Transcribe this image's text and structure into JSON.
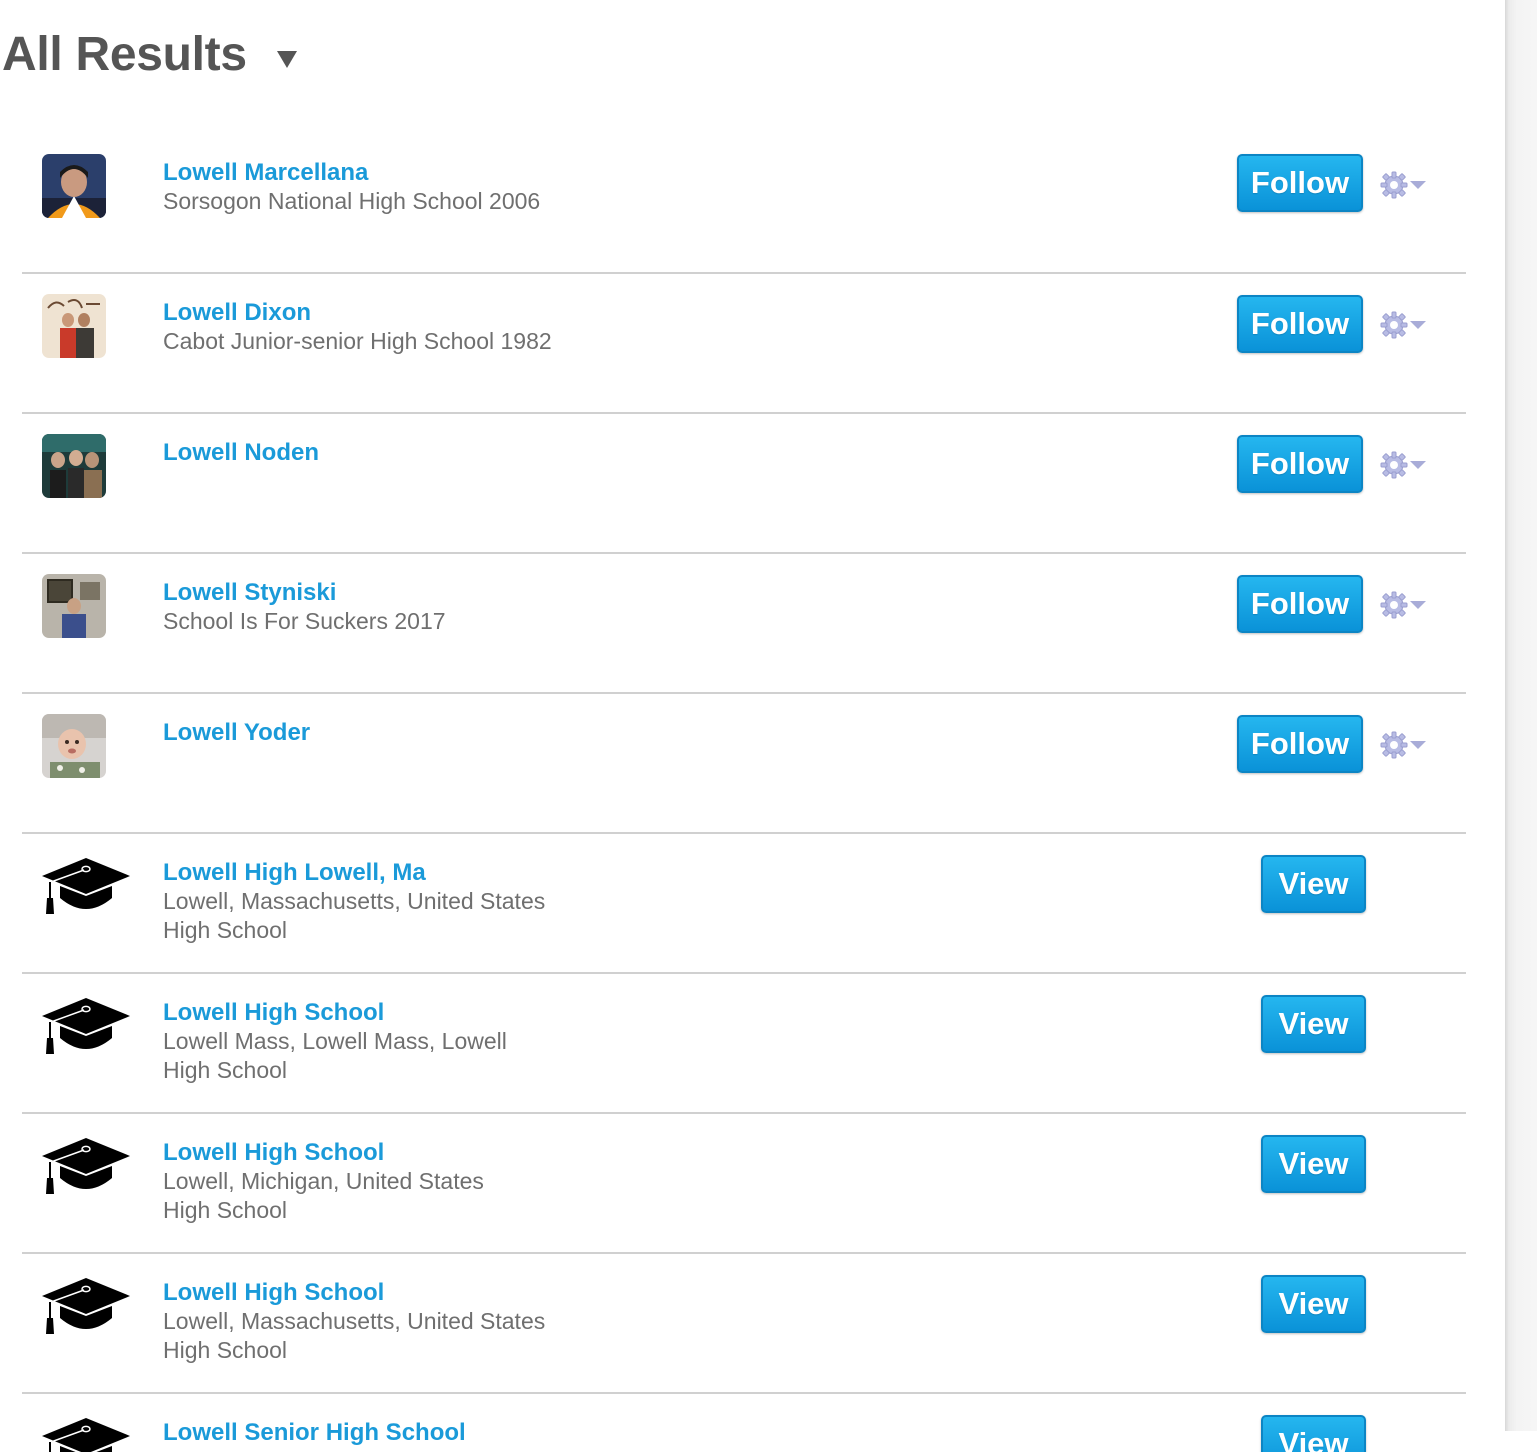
{
  "header": {
    "title": "All Results"
  },
  "buttons": {
    "follow": "Follow",
    "view": "View"
  },
  "people": [
    {
      "name": "Lowell Marcellana",
      "school": "Sorsogon National High School 2006"
    },
    {
      "name": "Lowell Dixon",
      "school": "Cabot Junior-senior High School 1982"
    },
    {
      "name": "Lowell Noden",
      "school": ""
    },
    {
      "name": "Lowell Styniski",
      "school": "School Is For Suckers 2017"
    },
    {
      "name": "Lowell Yoder",
      "school": ""
    }
  ],
  "schools": [
    {
      "name": "Lowell High Lowell, Ma",
      "location": "Lowell, Massachusetts, United States",
      "type": "High School"
    },
    {
      "name": "Lowell High School",
      "location": "Lowell Mass, Lowell Mass, Lowell",
      "type": "High School"
    },
    {
      "name": "Lowell High School",
      "location": "Lowell, Michigan, United States",
      "type": "High School"
    },
    {
      "name": "Lowell High School",
      "location": "Lowell, Massachusetts, United States",
      "type": "High School"
    },
    {
      "name": "Lowell Senior High School",
      "location": "",
      "type": ""
    }
  ],
  "icons": {
    "header_toggle": "triangle-down-icon",
    "person_menu": "gear-icon",
    "school": "graduation-cap-icon"
  },
  "colors": {
    "link": "#1a9ad9",
    "button": "#0a92d8",
    "title": "#555555",
    "subtext": "#6f6f6f"
  }
}
